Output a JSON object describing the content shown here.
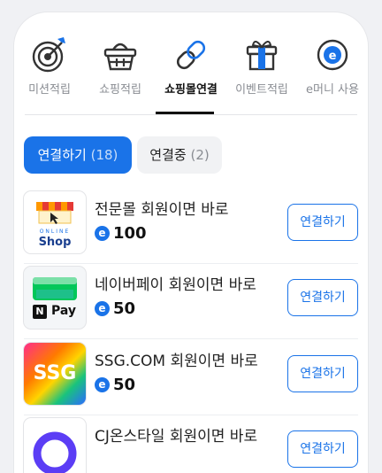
{
  "tabs": [
    {
      "label": "미션적립",
      "icon": "target-icon"
    },
    {
      "label": "쇼핑적립",
      "icon": "basket-icon"
    },
    {
      "label": "쇼핑몰연결",
      "icon": "link-icon",
      "active": true
    },
    {
      "label": "이벤트적립",
      "icon": "gift-icon"
    },
    {
      "label": "e머니 사용",
      "icon": "emoney-icon"
    }
  ],
  "segments": {
    "connect": {
      "label": "연결하기",
      "count": "(18)"
    },
    "connected": {
      "label": "연결중",
      "count": "(2)"
    }
  },
  "items": [
    {
      "title": "전문몰 회원이면 바로",
      "points": "100",
      "button": "연결하기",
      "logo_top": "ONLINE",
      "logo_text": "Shop"
    },
    {
      "title": "네이버페이 회원이면 바로",
      "points": "50",
      "button": "연결하기",
      "logo_text": "Pay",
      "logo_mark": "N"
    },
    {
      "title": "SSG.COM 회원이면 바로",
      "points": "50",
      "button": "연결하기",
      "logo_text": "SSG"
    },
    {
      "title": "CJ온스타일 회원이면 바로",
      "points": "",
      "button": "연결하기",
      "logo_text": ""
    }
  ],
  "coin_symbol": "e",
  "colors": {
    "accent": "#1a73e8",
    "naver": "#03c75a"
  }
}
